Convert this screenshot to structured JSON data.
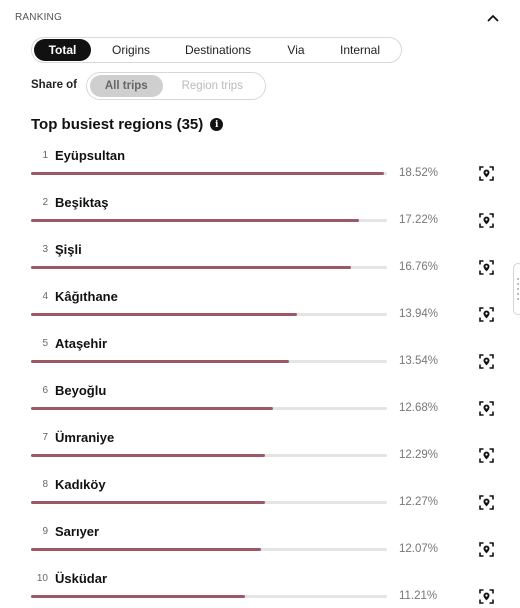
{
  "section": {
    "title": "RANKING"
  },
  "tabs": [
    {
      "label": "Total",
      "active": true
    },
    {
      "label": "Origins",
      "active": false
    },
    {
      "label": "Destinations",
      "active": false
    },
    {
      "label": "Via",
      "active": false
    },
    {
      "label": "Internal",
      "active": false
    }
  ],
  "share": {
    "label": "Share of",
    "options": [
      {
        "label": "All trips",
        "active": true
      },
      {
        "label": "Region trips",
        "active": false
      }
    ]
  },
  "list": {
    "title": "Top busiest regions (35)",
    "bar_color": "#9c5865",
    "items": [
      {
        "rank": "1",
        "name": "Eyüpsultan",
        "pct": "18.52%",
        "share": 18.52
      },
      {
        "rank": "2",
        "name": "Beşiktaş",
        "pct": "17.22%",
        "share": 17.22
      },
      {
        "rank": "3",
        "name": "Şişli",
        "pct": "16.76%",
        "share": 16.76
      },
      {
        "rank": "4",
        "name": "Kâğıthane",
        "pct": "13.94%",
        "share": 13.94
      },
      {
        "rank": "5",
        "name": "Ataşehir",
        "pct": "13.54%",
        "share": 13.54
      },
      {
        "rank": "6",
        "name": "Beyoğlu",
        "pct": "12.68%",
        "share": 12.68
      },
      {
        "rank": "7",
        "name": "Ümraniye",
        "pct": "12.29%",
        "share": 12.29
      },
      {
        "rank": "8",
        "name": "Kadıköy",
        "pct": "12.27%",
        "share": 12.27
      },
      {
        "rank": "9",
        "name": "Sarıyer",
        "pct": "12.07%",
        "share": 12.07
      },
      {
        "rank": "10",
        "name": "Üsküdar",
        "pct": "11.21%",
        "share": 11.21
      }
    ]
  }
}
